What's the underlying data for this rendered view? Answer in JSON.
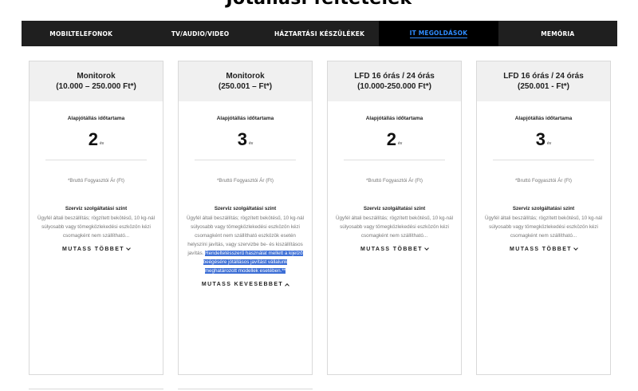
{
  "page_title": "Jótállási feltételek",
  "tabs": [
    {
      "label": "MOBILTELEFONOK",
      "active": false
    },
    {
      "label": "TV/AUDIO/VIDEO",
      "active": false
    },
    {
      "label": "HÁZTARTÁSI KÉSZÜLÉKEK",
      "active": false
    },
    {
      "label": "IT MEGOLDÁSOK",
      "active": true
    },
    {
      "label": "MEMÓRIA",
      "active": false
    }
  ],
  "cards": [
    {
      "title_line1": "Monitorok",
      "title_line2": "(10.000 – 250.000 Ft*)",
      "warranty_label": "Alapjótállás időtartama",
      "warranty_value": "2",
      "warranty_unit": "év",
      "price_note": "*Bruttó Fogyasztói Ár (Ft)",
      "service_title": "Szerviz szolgáltatási szint",
      "service_text": "Ügyfél általi beszállítás; rögzített bekötésű, 10 kg-nál súlyosabb vagy tömegközlekedési eszközön kézi csomagként nem szállítható...",
      "service_text_highlight": "",
      "toggle_label": "MUTASS TÖBBET",
      "expanded": false
    },
    {
      "title_line1": "Monitorok",
      "title_line2": "(250.001 – Ft*)",
      "warranty_label": "Alapjótállás időtartama",
      "warranty_value": "3",
      "warranty_unit": "év",
      "price_note": "*Bruttó Fogyasztói Ár (Ft)",
      "service_title": "Szerviz szolgáltatási szint",
      "service_text": "Ügyfél általi beszállítás; rögzített bekötésű, 10 kg-nál súlyosabb vagy tömegközlekedési eszközön kézi csomagként nem szállítható eszközök esetén helyszíni javítás, vagy szervizbe be- és kiszállításos javítás. ",
      "service_text_highlight": "Rendeltetésszerű használat mellett a kijelző beégésére jótállásos javítást vállalunk meghatározott modellek esetében.**",
      "toggle_label": "MUTASS KEVESEBBET",
      "expanded": true
    },
    {
      "title_line1": "LFD 16 órás / 24 órás",
      "title_line2": "(10.000-250.000 Ft*)",
      "warranty_label": "Alapjótállás időtartama",
      "warranty_value": "2",
      "warranty_unit": "év",
      "price_note": "*Bruttó Fogyasztói Ár (Ft)",
      "service_title": "Szerviz szolgáltatási szint",
      "service_text": "Ügyfél általi beszállítás; rögzített bekötésű, 10 kg-nál súlyosabb vagy tömegközlekedési eszközön kézi csomagként nem szállítható...",
      "service_text_highlight": "",
      "toggle_label": "MUTASS TÖBBET",
      "expanded": false
    },
    {
      "title_line1": "LFD 16 órás / 24 órás",
      "title_line2": "(250.001 - Ft*)",
      "warranty_label": "Alapjótállás időtartama",
      "warranty_value": "3",
      "warranty_unit": "év",
      "price_note": "*Bruttó Fogyasztói Ár (Ft)",
      "service_title": "Szerviz szolgáltatási szint",
      "service_text": "Ügyfél általi beszállítás; rögzített bekötésű, 10 kg-nál súlyosabb vagy tömegközlekedési eszközön kézi csomagként nem szállítható...",
      "service_text_highlight": "",
      "toggle_label": "MUTASS TÖBBET",
      "expanded": false
    }
  ],
  "colors": {
    "tab_bar": "#1f1f1f",
    "tab_active_text": "#2f8cff",
    "highlight": "#3d6fd6",
    "card_header": "#f0f0f0"
  }
}
